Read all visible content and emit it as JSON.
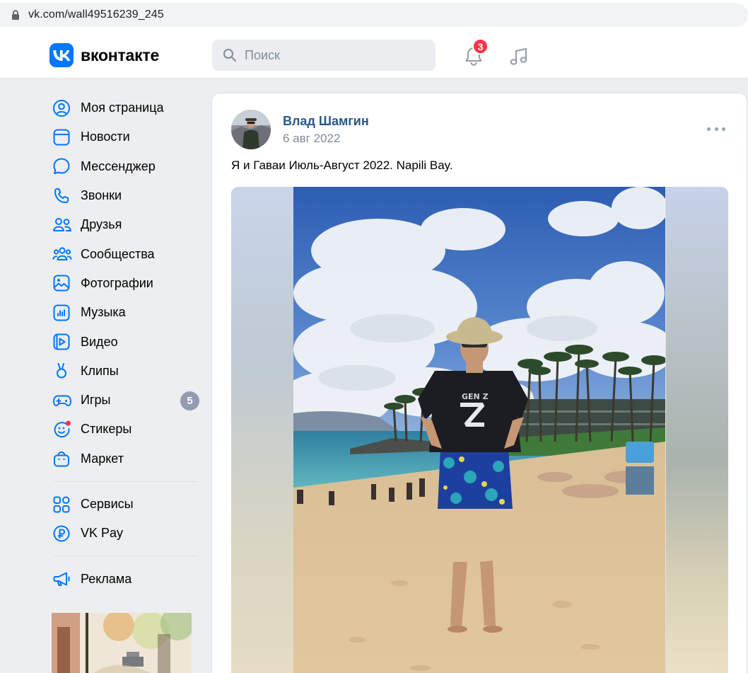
{
  "browser": {
    "url": "vk.com/wall49516239_245"
  },
  "header": {
    "logo_text": "вконтакте",
    "search_placeholder": "Поиск",
    "notifications_count": "3"
  },
  "sidebar": {
    "items": [
      {
        "label": "Моя страница",
        "icon": "user-circle-icon"
      },
      {
        "label": "Новости",
        "icon": "newsfeed-icon"
      },
      {
        "label": "Мессенджер",
        "icon": "message-icon"
      },
      {
        "label": "Звонки",
        "icon": "phone-icon"
      },
      {
        "label": "Друзья",
        "icon": "friends-icon"
      },
      {
        "label": "Сообщества",
        "icon": "communities-icon"
      },
      {
        "label": "Фотографии",
        "icon": "photos-icon"
      },
      {
        "label": "Музыка",
        "icon": "music-icon"
      },
      {
        "label": "Видео",
        "icon": "video-icon"
      },
      {
        "label": "Клипы",
        "icon": "clips-icon"
      },
      {
        "label": "Игры",
        "icon": "gamepad-icon",
        "badge": "5"
      },
      {
        "label": "Стикеры",
        "icon": "stickers-icon"
      },
      {
        "label": "Маркет",
        "icon": "market-icon"
      }
    ],
    "items2": [
      {
        "label": "Сервисы",
        "icon": "services-icon"
      },
      {
        "label": "VK Pay",
        "icon": "vkpay-icon"
      }
    ],
    "items3": [
      {
        "label": "Реклама",
        "icon": "megaphone-icon"
      }
    ]
  },
  "post": {
    "author": "Влад Шамгин",
    "date": "6 авг 2022",
    "text": "Я и Гаваи Июль-Август 2022. Napili Bay.",
    "shirt_text": "GEN Z"
  },
  "colors": {
    "accent": "#0077ff",
    "link": "#2a5885",
    "badge_red": "#ff3347"
  }
}
